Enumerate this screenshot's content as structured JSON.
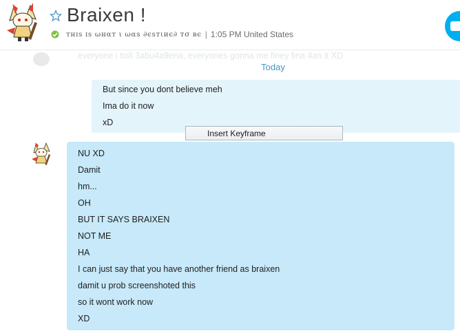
{
  "header": {
    "contact_name": "Braixen !",
    "mood_message": "ᴛʜɪs ɪs ωнαт ι ωαѕ ∂єѕтιиє∂ тσ вє",
    "separator": "|",
    "local_time": "1:05 PM United States",
    "status": "online",
    "favorite_icon": "star-outline-icon",
    "call_button_icon": "video-call-icon"
  },
  "chat": {
    "faded_previous_message": "everyone i toill 3abu4a9ena, everyones gonna me finey fina 4an it XD",
    "day_separator": "Today",
    "outgoing_messages": [
      "But since you dont believe meh",
      "Ima do it now",
      "xD"
    ],
    "incoming_messages": [
      "NU XD",
      "Damit",
      "hm...",
      "OH",
      "BUT IT SAYS BRAIXEN",
      "NOT ME",
      "HA",
      "I can just say that you have another friend as braixen",
      "damit u prob screenshoted this",
      "so it wont work now",
      "XD"
    ]
  },
  "context_menu": {
    "item_label": "Insert Keyframe"
  },
  "colors": {
    "accent": "#00aff0",
    "day_label": "#4a94c8",
    "incoming_bubble": "#c7e9f9",
    "outgoing_bubble": "#e4f4fb",
    "online": "#7dc242"
  }
}
